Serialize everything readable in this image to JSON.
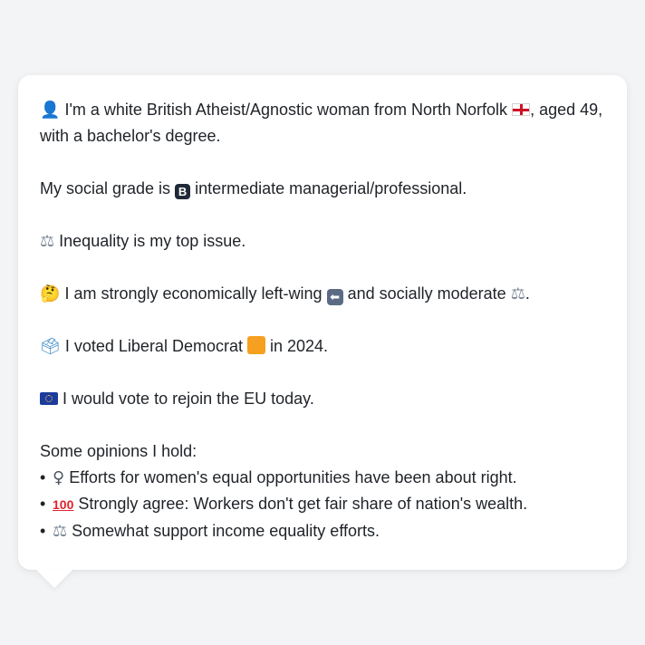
{
  "profile": {
    "line1": {
      "icon": "person-silhouette-icon",
      "text_a": "I'm a white British Atheist/Agnostic woman from North Norfolk",
      "flag": "england-flag-icon",
      "text_b": ", aged 49, with a bachelor's degree."
    },
    "line2": {
      "text_a": "My social grade is",
      "badge": "B",
      "text_b": "intermediate managerial/professional."
    },
    "line3": {
      "icon": "balance-scale-icon",
      "text": "Inequality is my top issue."
    },
    "line4": {
      "icon": "thinking-face-icon",
      "text_a": "I am strongly economically left-wing",
      "arrow_icon": "left-arrow-icon",
      "text_b": "and socially moderate",
      "end_icon": "balance-scale-icon",
      "text_c": "."
    },
    "line5": {
      "icon": "ballot-box-icon",
      "text_a": "I voted Liberal Democrat",
      "square_icon": "orange-square-icon",
      "square_color": "#f5a020",
      "text_b": "in 2024."
    },
    "line6": {
      "icon": "eu-flag-icon",
      "text": "I would vote to rejoin the EU today."
    }
  },
  "opinions": {
    "title": "Some opinions I hold:",
    "items": [
      {
        "icon": "female-sign-icon",
        "glyph": "♀",
        "text": "Efforts for women's equal opportunities have been about right."
      },
      {
        "icon": "hundred-points-icon",
        "glyph": "100",
        "text": "Strongly agree: Workers don't get fair share of nation's wealth."
      },
      {
        "icon": "balance-scale-icon",
        "glyph": "⚖",
        "text": "Somewhat support income equality efforts."
      }
    ]
  }
}
